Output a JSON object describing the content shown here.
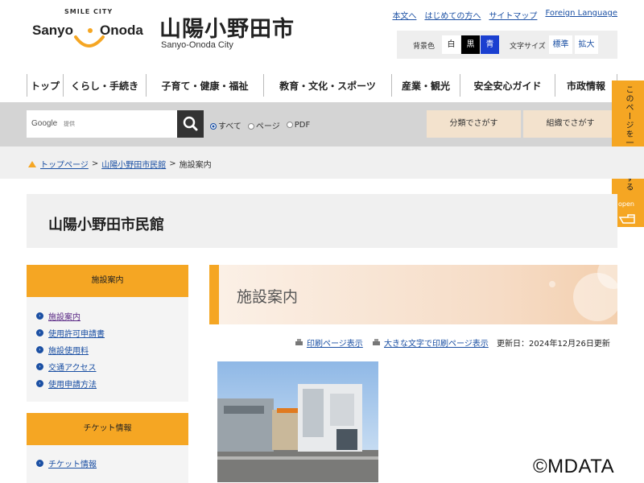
{
  "header": {
    "logo_text_left": "Sanyo",
    "logo_text_right": "noda",
    "logo_tagline": "SMILE CITY",
    "city_name_jp": "山陽小野田市",
    "city_name_en": "Sanyo-Onoda City"
  },
  "util_links": [
    {
      "label": "本文へ"
    },
    {
      "label": "はじめての方へ"
    },
    {
      "label": "サイトマップ"
    },
    {
      "label": "Foreign Language"
    }
  ],
  "display": {
    "bg_label": "背景色",
    "bg_white": "白",
    "bg_black": "黒",
    "bg_blue": "青",
    "size_label": "文字サイズ",
    "size_standard": "標準",
    "size_large": "拡大"
  },
  "gnav": [
    {
      "label": "トップ"
    },
    {
      "label": "くらし・手続き"
    },
    {
      "label": "子育て・健康・福祉"
    },
    {
      "label": "教育・文化・スポーツ"
    },
    {
      "label": "産業・観光"
    },
    {
      "label": "安全安心ガイド"
    },
    {
      "label": "市政情報"
    }
  ],
  "search": {
    "google_label": "Google",
    "provided_label": "提供",
    "options": [
      {
        "label": "すべて",
        "selected": true
      },
      {
        "label": "ページ",
        "selected": false
      },
      {
        "label": "PDF",
        "selected": false
      }
    ],
    "category_button": "分類でさがす",
    "org_button": "組織でさがす"
  },
  "side_tab": {
    "label": "このページを一時保存する",
    "open": "open"
  },
  "breadcrumb": {
    "home": "トップページ",
    "parent": "山陽小野田市民館",
    "sep": ">",
    "current": "施設案内"
  },
  "page_title": "山陽小野田市民館",
  "sidebar": {
    "section1_title": "施設案内",
    "section1_items": [
      {
        "label": "施設案内"
      },
      {
        "label": "使用許可申請書"
      },
      {
        "label": "施設使用料"
      },
      {
        "label": "交通アクセス"
      },
      {
        "label": "使用申請方法"
      }
    ],
    "section2_title": "チケット情報",
    "section2_items": [
      {
        "label": "チケット情報"
      }
    ]
  },
  "main": {
    "heading": "施設案内",
    "print_link": "印刷ページ表示",
    "large_print_link": "大きな文字で印刷ページ表示",
    "updated": "更新日：2024年12月26日更新"
  },
  "watermark": "©MDATA",
  "colors": {
    "accent": "#f5a623",
    "link": "#1a4fa3",
    "band": "#d4d4d4",
    "light": "#f0f0f0"
  }
}
